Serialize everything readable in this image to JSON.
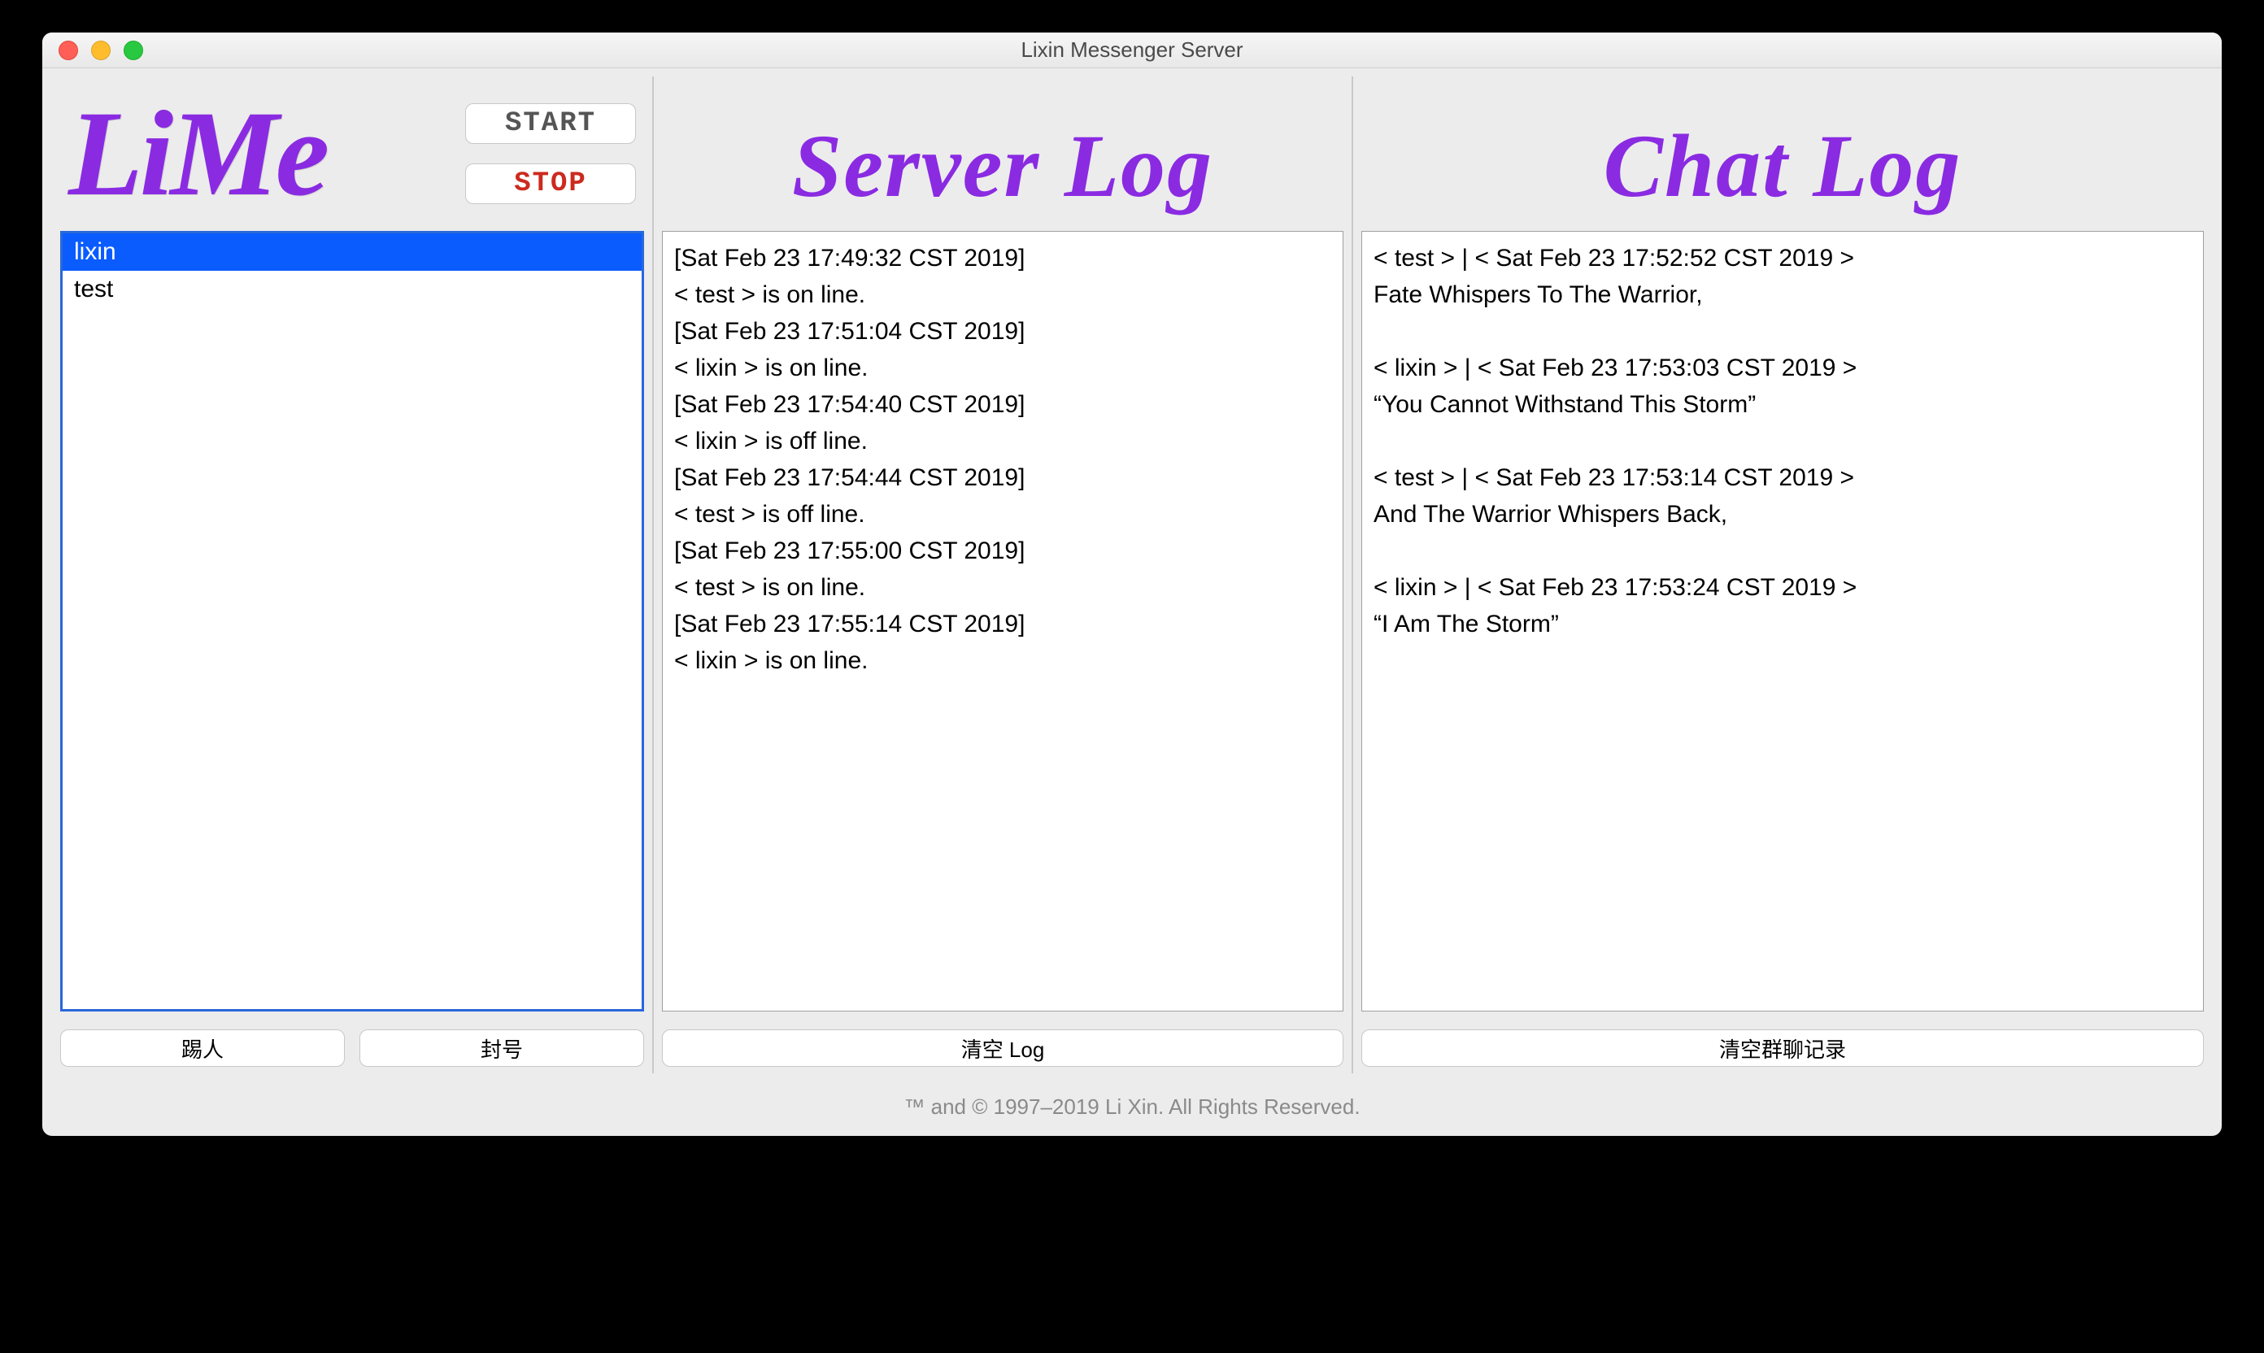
{
  "window": {
    "title": "Lixin Messenger Server"
  },
  "left": {
    "logo": "LiMe",
    "start_label": "START",
    "stop_label": "STOP",
    "users": [
      {
        "name": "lixin",
        "selected": true
      },
      {
        "name": "test",
        "selected": false
      }
    ],
    "kick_label": "踢人",
    "ban_label": "封号"
  },
  "server_log": {
    "title": "Server Log",
    "entries": [
      "[Sat Feb 23 17:49:32 CST 2019]",
      "< test > is on line.",
      "[Sat Feb 23 17:51:04 CST 2019]",
      "< lixin > is on line.",
      "[Sat Feb 23 17:54:40 CST 2019]",
      "< lixin > is off line.",
      "[Sat Feb 23 17:54:44 CST 2019]",
      "< test > is off line.",
      "[Sat Feb 23 17:55:00 CST 2019]",
      "< test > is on line.",
      "[Sat Feb 23 17:55:14 CST 2019]",
      "< lixin > is on line."
    ],
    "clear_label": "清空 Log"
  },
  "chat_log": {
    "title": "Chat Log",
    "entries": [
      "< test > | < Sat Feb 23 17:52:52 CST 2019 >",
      "Fate Whispers To The Warrior,",
      "",
      "< lixin > | < Sat Feb 23 17:53:03 CST 2019 >",
      "“You Cannot Withstand This Storm”",
      "",
      "< test > | < Sat Feb 23 17:53:14 CST 2019 >",
      "And The Warrior Whispers Back,",
      "",
      "< lixin > | < Sat Feb 23 17:53:24 CST 2019 >",
      "“I Am The Storm”"
    ],
    "clear_label": "清空群聊记录"
  },
  "footer": {
    "text": "™ and © 1997–2019 Li Xin. All Rights Reserved."
  }
}
